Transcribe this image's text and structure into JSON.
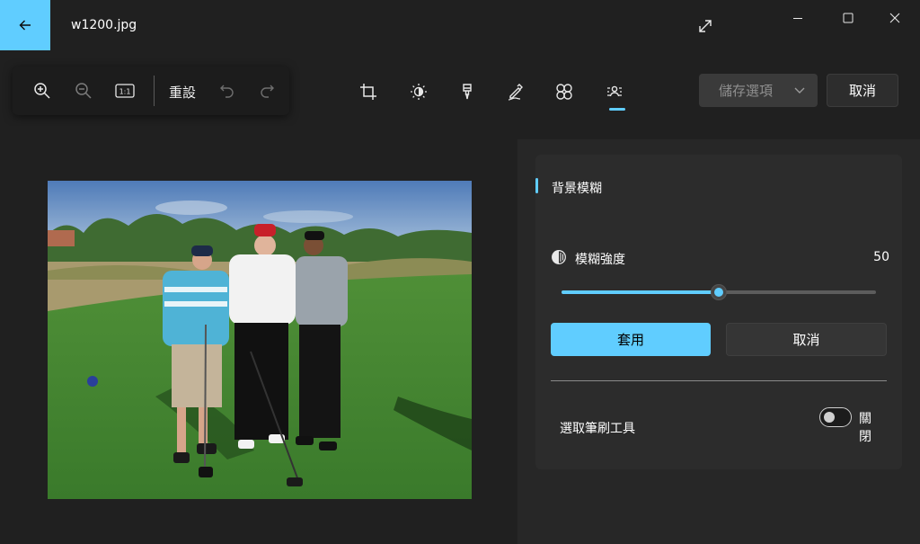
{
  "window": {
    "title": "w1200.jpg",
    "back_icon": "arrow-left-icon",
    "expand_icon": "expand-icon",
    "controls": [
      "minimize-icon",
      "maximize-icon",
      "close-icon"
    ],
    "accent_color": "#60cdff"
  },
  "toolbar": {
    "zoom_tools": [
      "zoom-in-icon",
      "zoom-out-icon",
      "actual-size-icon"
    ],
    "actual_size_label": "1:1",
    "reset_label": "重設",
    "history_tools": [
      "undo-icon",
      "redo-icon"
    ],
    "edit_tools": [
      "crop-icon",
      "adjust-brightness-icon",
      "retouch-icon",
      "markup-icon",
      "filter-icon",
      "background-blur-icon"
    ],
    "active_edit_tool": "background-blur-icon",
    "save_label": "儲存選項",
    "cancel_label": "取消"
  },
  "photo": {
    "description_icon": "photo-golfers"
  },
  "panel": {
    "title": "背景模糊",
    "strength_label": "模糊強度",
    "strength_value": "50",
    "strength_fraction": 0.5,
    "apply_label": "套用",
    "cancel_label": "取消",
    "brush_label": "選取筆刷工具",
    "brush_state": "關閉",
    "brush_enabled": false
  }
}
